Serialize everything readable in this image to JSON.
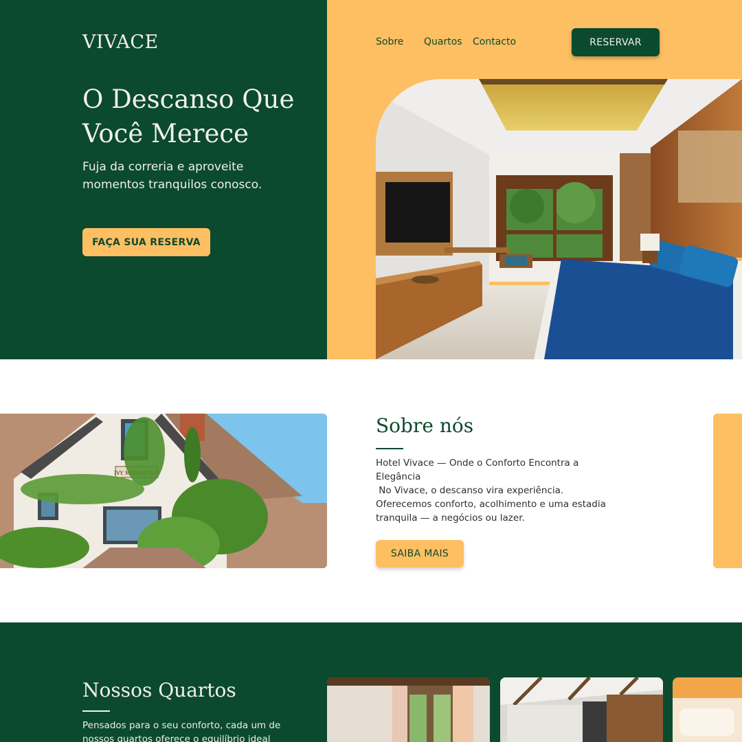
{
  "brand": {
    "logo": "VIVACE"
  },
  "nav": {
    "items": [
      "Sobre",
      "Quartos",
      "Contacto"
    ],
    "reserve_label": "RESERVAR"
  },
  "hero": {
    "title": "O Descanso Que Você Merece",
    "subtitle": "Fuja da correria e aproveite momentos tranquilos conosco.",
    "cta_label": "FAÇA SUA RESERVA"
  },
  "about": {
    "title": "Sobre nós",
    "lead": "Hotel Vivace — Onde o Conforto Encontra a Elegância",
    "body": " No Vivace, o descanso vira experiência. Oferecemos conforto, acolhimento e uma estadia tranquila — a negócios ou lazer.",
    "cta_label": "SAIBA MAIS",
    "sign_text": "IVY MANOR INN"
  },
  "rooms": {
    "title": "Nossos Quartos",
    "text": "Pensados para o seu conforto, cada um de nossos quartos oferece o equilíbrio ideal"
  },
  "colors": {
    "green": "#0b4a2e",
    "yellow": "#fdbf62",
    "cream": "#f4f1ea"
  }
}
